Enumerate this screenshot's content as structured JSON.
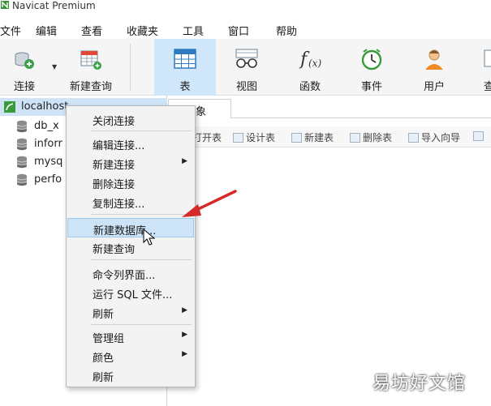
{
  "app": {
    "title": "Navicat Premium"
  },
  "menu": [
    "文件",
    "编辑",
    "查看",
    "收藏夹",
    "工具",
    "窗口",
    "帮助"
  ],
  "toolbar": {
    "connect": "连接",
    "new_query": "新建查询",
    "table": "表",
    "view": "视图",
    "function": "函数",
    "event": "事件",
    "user": "用户",
    "more": "查"
  },
  "tree": {
    "connection": "localhost",
    "databases": [
      "db_x",
      "inforr",
      "mysq",
      "perfo"
    ]
  },
  "object_tab": {
    "label": "对象"
  },
  "object_toolbar": [
    "打开表",
    "设计表",
    "新建表",
    "删除表",
    "导入向导"
  ],
  "context_menu": {
    "items": [
      {
        "label": "关闭连接",
        "submenu": false
      },
      {
        "label": "编辑连接...",
        "submenu": false
      },
      {
        "label": "新建连接",
        "submenu": true
      },
      {
        "label": "删除连接",
        "submenu": false
      },
      {
        "label": "复制连接...",
        "submenu": false
      },
      {
        "label": "新建数据库...",
        "submenu": false,
        "highlighted": true
      },
      {
        "label": "新建查询",
        "submenu": false
      },
      {
        "label": "命令列界面...",
        "submenu": false
      },
      {
        "label": "运行 SQL 文件...",
        "submenu": false
      },
      {
        "label": "刷新",
        "submenu": true
      },
      {
        "label": "管理组",
        "submenu": true
      },
      {
        "label": "颜色",
        "submenu": true
      },
      {
        "label": "刷新",
        "submenu": false
      }
    ]
  },
  "watermark": "易坊好文馆",
  "colors": {
    "highlight": "#cde3f7",
    "active_tool": "#cfe6fb",
    "arrow": "#d42a2a"
  }
}
